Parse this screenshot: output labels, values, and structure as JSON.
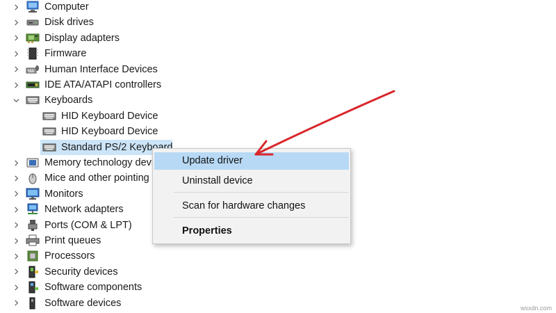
{
  "tree": {
    "items": [
      {
        "id": "computer",
        "label": "Computer",
        "expanded": false,
        "level": 0,
        "icon": "computer-icon"
      },
      {
        "id": "disk-drives",
        "label": "Disk drives",
        "expanded": false,
        "level": 0,
        "icon": "disk-drive-icon"
      },
      {
        "id": "display-adapters",
        "label": "Display adapters",
        "expanded": false,
        "level": 0,
        "icon": "display-adapter-icon"
      },
      {
        "id": "firmware",
        "label": "Firmware",
        "expanded": false,
        "level": 0,
        "icon": "firmware-icon"
      },
      {
        "id": "hid",
        "label": "Human Interface Devices",
        "expanded": false,
        "level": 0,
        "icon": "hid-icon"
      },
      {
        "id": "ide",
        "label": "IDE ATA/ATAPI controllers",
        "expanded": false,
        "level": 0,
        "icon": "ide-controller-icon"
      },
      {
        "id": "keyboards",
        "label": "Keyboards",
        "expanded": true,
        "level": 0,
        "icon": "keyboard-icon"
      },
      {
        "id": "hid-keyboard-1",
        "label": "HID Keyboard Device",
        "level": 1,
        "icon": "keyboard-icon"
      },
      {
        "id": "hid-keyboard-2",
        "label": "HID Keyboard Device",
        "level": 1,
        "icon": "keyboard-icon"
      },
      {
        "id": "ps2-keyboard",
        "label": "Standard PS/2 Keyboard",
        "level": 1,
        "icon": "keyboard-icon",
        "selected": true
      },
      {
        "id": "memory-tech",
        "label": "Memory technology devices",
        "expanded": false,
        "level": 0,
        "icon": "memory-icon"
      },
      {
        "id": "mice",
        "label": "Mice and other pointing devices",
        "expanded": false,
        "level": 0,
        "icon": "mouse-icon"
      },
      {
        "id": "monitors",
        "label": "Monitors",
        "expanded": false,
        "level": 0,
        "icon": "monitor-icon"
      },
      {
        "id": "network",
        "label": "Network adapters",
        "expanded": false,
        "level": 0,
        "icon": "network-adapter-icon"
      },
      {
        "id": "ports",
        "label": "Ports (COM & LPT)",
        "expanded": false,
        "level": 0,
        "icon": "port-icon"
      },
      {
        "id": "print-queues",
        "label": "Print queues",
        "expanded": false,
        "level": 0,
        "icon": "printer-icon"
      },
      {
        "id": "processors",
        "label": "Processors",
        "expanded": false,
        "level": 0,
        "icon": "processor-icon"
      },
      {
        "id": "security",
        "label": "Security devices",
        "expanded": false,
        "level": 0,
        "icon": "security-device-icon"
      },
      {
        "id": "sw-components",
        "label": "Software components",
        "expanded": false,
        "level": 0,
        "icon": "software-component-icon"
      },
      {
        "id": "sw-devices",
        "label": "Software devices",
        "expanded": false,
        "level": 0,
        "icon": "software-device-icon"
      }
    ]
  },
  "context_menu": {
    "update_driver": "Update driver",
    "uninstall_device": "Uninstall device",
    "scan_hardware": "Scan for hardware changes",
    "properties": "Properties"
  },
  "watermark": "wsxdn.com",
  "colors": {
    "selection": "#cce4f7",
    "menu_highlight": "#b7d9f5",
    "menu_background": "#f2f2f2",
    "annotation_arrow": "#d9262b"
  }
}
